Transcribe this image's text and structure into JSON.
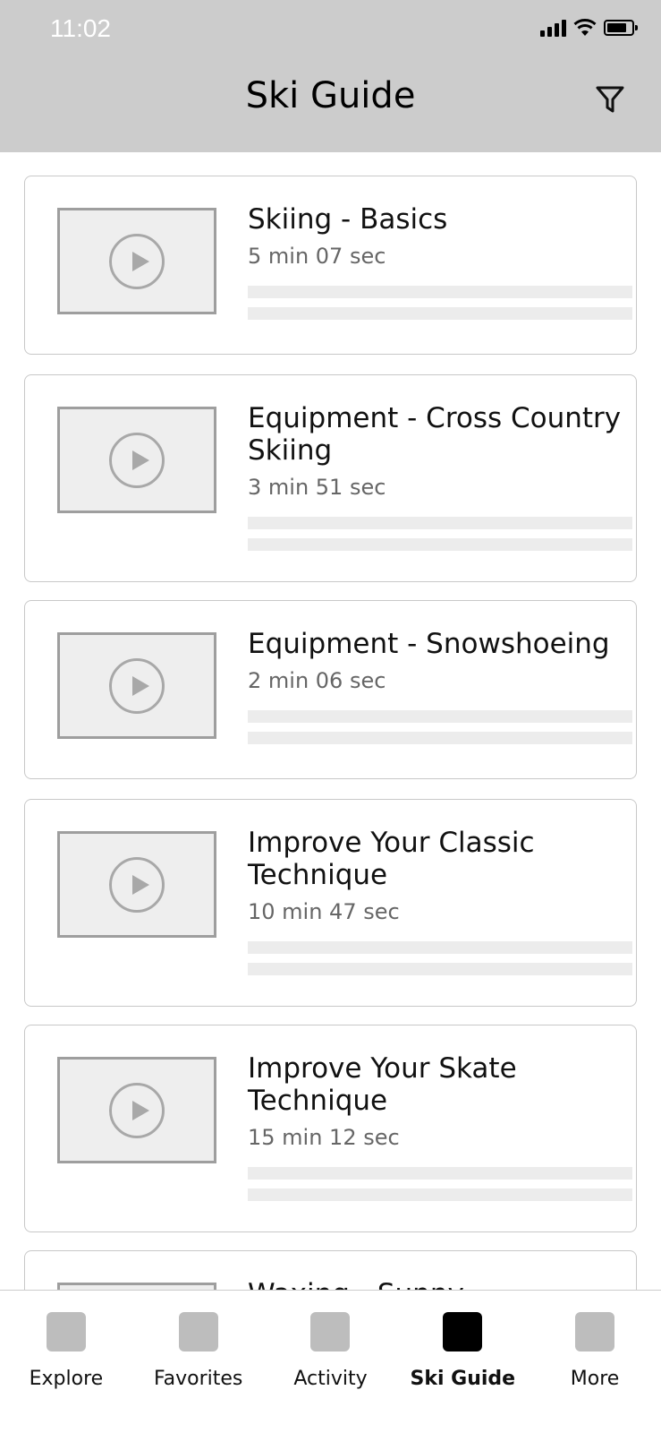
{
  "status_bar": {
    "time": "11:02"
  },
  "header": {
    "title": "Ski Guide",
    "filter_icon": "filter-icon"
  },
  "videos": [
    {
      "title": "Skiing - Basics",
      "duration": "5 min 07 sec"
    },
    {
      "title": "Equipment - Cross Country Skiing",
      "duration": "3 min 51 sec"
    },
    {
      "title": "Equipment - Snowshoeing",
      "duration": "2 min 06 sec"
    },
    {
      "title": "Improve Your Classic Technique",
      "duration": "10 min 47 sec"
    },
    {
      "title": "Improve Your Skate Technique",
      "duration": "15 min 12 sec"
    },
    {
      "title": "Waxing - Sunny",
      "duration": ""
    }
  ],
  "bottom_nav": {
    "items": [
      {
        "label": "Explore",
        "active": false
      },
      {
        "label": "Favorites",
        "active": false
      },
      {
        "label": "Activity",
        "active": false
      },
      {
        "label": "Ski Guide",
        "active": true
      },
      {
        "label": "More",
        "active": false
      }
    ]
  },
  "colors": {
    "header_bg": "#cccccc",
    "placeholder": "#eeeeee",
    "active_nav": "#000000",
    "inactive_nav": "#bdbdbd"
  }
}
